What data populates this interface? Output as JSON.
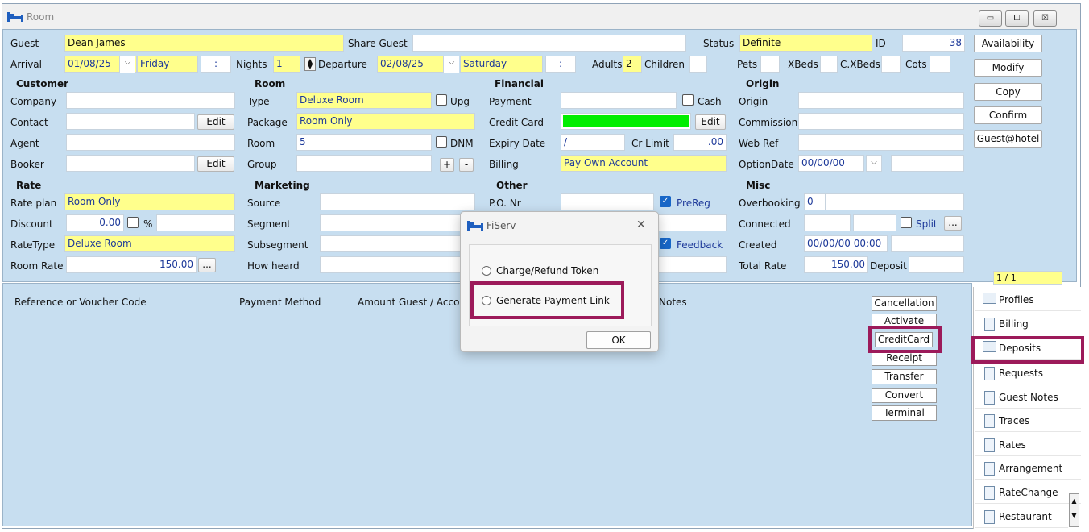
{
  "window": {
    "title": "Room",
    "min": "▭",
    "max": "⧠",
    "close": "☒"
  },
  "guest": {
    "guest_label": "Guest",
    "guest_value": "Dean James",
    "share_label": "Share Guest",
    "status_label": "Status",
    "status_value": "Definite",
    "id_label": "ID",
    "id_value": "38"
  },
  "arrival": {
    "arrival_label": "Arrival",
    "arrival_date": "01/08/25",
    "arrival_day": "Friday",
    "arrival_time": ":",
    "nights_label": "Nights",
    "nights_value": "1",
    "departure_label": "Departure",
    "departure_date": "02/08/25",
    "departure_day": "Saturday",
    "departure_time": ":",
    "adults_label": "Adults",
    "adults_value": "2",
    "children_label": "Children",
    "pets_label": "Pets",
    "xbeds_label": "XBeds",
    "cxbeds_label": "C.XBeds",
    "cots_label": "Cots"
  },
  "right_buttons": [
    "Availability",
    "Modify",
    "Copy",
    "Confirm",
    "Guest@hotel"
  ],
  "customer": {
    "header": "Customer",
    "company": "Company",
    "contact": "Contact",
    "agent": "Agent",
    "booker": "Booker",
    "edit": "Edit"
  },
  "room": {
    "header": "Room",
    "type_label": "Type",
    "type_value": "Deluxe Room",
    "upg": "Upg",
    "package_label": "Package",
    "package_value": "Room Only",
    "room_label": "Room",
    "room_value": "5",
    "dnm": "DNM",
    "group_label": "Group",
    "plus": "+",
    "minus": "-"
  },
  "financial": {
    "header": "Financial",
    "payment": "Payment",
    "cash": "Cash",
    "credit_card": "Credit Card",
    "edit": "Edit",
    "expiry": "Expiry Date",
    "expiry_value": "/",
    "cr_limit": "Cr Limit",
    "cr_limit_value": ".00",
    "billing": "Billing",
    "billing_value": "Pay Own Account"
  },
  "origin": {
    "header": "Origin",
    "origin": "Origin",
    "commission": "Commission",
    "webref": "Web Ref",
    "optiondate": "OptionDate",
    "optiondate_value": "00/00/00"
  },
  "rate": {
    "header": "Rate",
    "rateplan_label": "Rate plan",
    "rateplan_value": "Room Only",
    "discount_label": "Discount",
    "discount_value": "0.00",
    "pct": "%",
    "ratetype_label": "RateType",
    "ratetype_value": "Deluxe Room",
    "roomrate_label": "Room Rate",
    "roomrate_value": "150.00",
    "more": "..."
  },
  "marketing": {
    "header": "Marketing",
    "source": "Source",
    "segment": "Segment",
    "subsegment": "Subsegment",
    "howheard": "How heard"
  },
  "other": {
    "header": "Other",
    "po": "P.O. Nr",
    "prereg": "PreReg",
    "feedback": "Feedback"
  },
  "misc": {
    "header": "Misc",
    "overbooking": "Overbooking",
    "overbooking_value": "0",
    "connected": "Connected",
    "split": "Split",
    "more": "...",
    "created": "Created",
    "created_value": "00/00/00 00:00",
    "total_rate": "Total Rate",
    "total_rate_value": "150.00",
    "deposit": "Deposit",
    "pager": "1 / 1"
  },
  "table_headers": {
    "ref": "Reference or Voucher Code",
    "method": "Payment Method",
    "amount": "Amount Guest / Acco",
    "notes": "Notes"
  },
  "action_buttons": [
    "Cancellation",
    "Activate",
    "CreditCard",
    "Receipt",
    "Transfer",
    "Convert",
    "Terminal"
  ],
  "side_tabs": [
    "Profiles",
    "Billing",
    "Deposits",
    "Requests",
    "Guest Notes",
    "Traces",
    "Rates",
    "Arrangement",
    "RateChange",
    "Restaurant"
  ],
  "dialog": {
    "title": "FiServ",
    "close": "✕",
    "option1": "Charge/Refund Token",
    "option2": "Generate Payment Link",
    "ok": "OK"
  },
  "colors": {
    "highlight": "#9c1a5a",
    "panel": "#c7def0",
    "yellow": "#ffff8c",
    "green": "#00ee00"
  }
}
